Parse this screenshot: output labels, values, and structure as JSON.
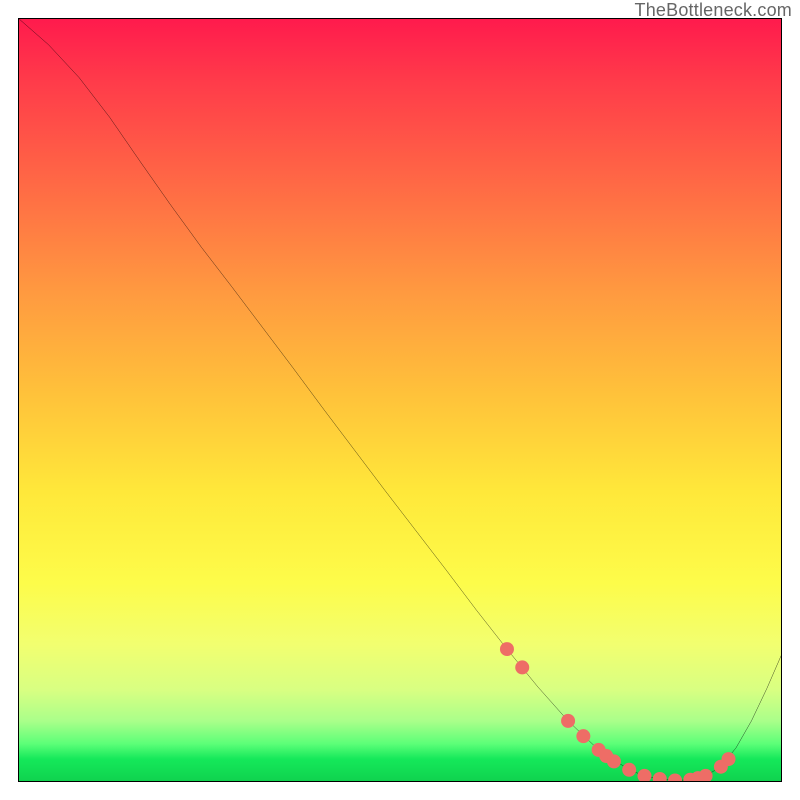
{
  "watermark": "TheBottleneck.com",
  "chart_data": {
    "type": "line",
    "title": "",
    "xlabel": "",
    "ylabel": "",
    "xlim": [
      0,
      100
    ],
    "ylim": [
      0,
      100
    ],
    "series": [
      {
        "name": "curve",
        "x": [
          0,
          4,
          8,
          12,
          16,
          20,
          24,
          28,
          32,
          36,
          40,
          44,
          48,
          52,
          56,
          60,
          64,
          68,
          72,
          76,
          80,
          82,
          84,
          86,
          88,
          90,
          92,
          94,
          96,
          98,
          100
        ],
        "y": [
          100,
          96.5,
          92.2,
          87.0,
          81.2,
          75.5,
          70.0,
          64.8,
          59.5,
          54.2,
          48.8,
          43.5,
          38.2,
          33.0,
          27.8,
          22.5,
          17.4,
          12.5,
          8.0,
          4.2,
          1.6,
          0.8,
          0.4,
          0.2,
          0.3,
          0.8,
          2.0,
          4.5,
          8.0,
          12.2,
          16.8
        ]
      }
    ],
    "markers": {
      "series": "curve",
      "x": [
        64,
        66,
        72,
        74,
        76,
        77,
        78,
        80,
        82,
        84,
        86,
        88,
        89,
        90,
        92,
        93
      ],
      "y": [
        17.4,
        15.0,
        8.0,
        6.0,
        4.2,
        3.4,
        2.7,
        1.6,
        0.8,
        0.4,
        0.2,
        0.3,
        0.5,
        0.8,
        2.0,
        3.0
      ],
      "color": "#ee6d66",
      "radius": 7
    },
    "gradient_stops": [
      {
        "pos": 0.0,
        "color": "#ff1a4d"
      },
      {
        "pos": 0.5,
        "color": "#ffc43a"
      },
      {
        "pos": 0.8,
        "color": "#f2ff70"
      },
      {
        "pos": 1.0,
        "color": "#0fd24e"
      }
    ]
  }
}
